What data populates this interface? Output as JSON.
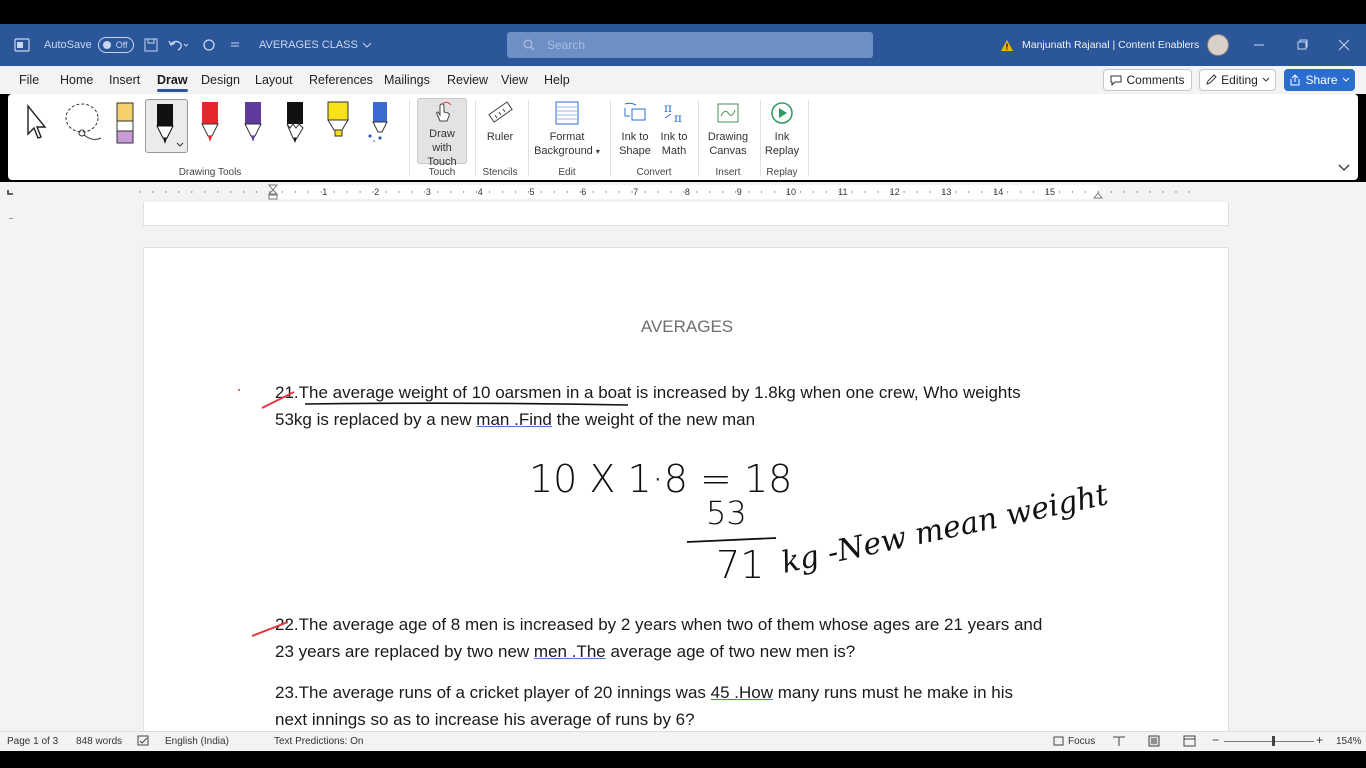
{
  "titlebar": {
    "autosave_label": "AutoSave",
    "autosave_state": "Off",
    "doc_name": "AVERAGES CLASS",
    "search_placeholder": "Search",
    "user": "Manjunath Rajanal | Content Enablers"
  },
  "menu": {
    "tabs": [
      "File",
      "Home",
      "Insert",
      "Draw",
      "Design",
      "Layout",
      "References",
      "Mailings",
      "Review",
      "View",
      "Help"
    ],
    "active_tab": "Draw",
    "comments_label": "Comments",
    "editing_label": "Editing",
    "share_label": "Share"
  },
  "ribbon": {
    "groups": {
      "drawing_tools": "Drawing Tools",
      "touch": "Touch",
      "stencils": "Stencils",
      "edit": "Edit",
      "convert": "Convert",
      "insert": "Insert",
      "replay": "Replay"
    },
    "buttons": {
      "draw_with_touch": "Draw with Touch",
      "ruler": "Ruler",
      "format_background": "Format Background",
      "ink_to_shape": "Ink to Shape",
      "ink_to_math": "Ink to Math",
      "drawing_canvas": "Drawing Canvas",
      "ink_replay": "Ink Replay"
    }
  },
  "ruler": {
    "numbers": [
      "1",
      "2",
      "3",
      "4",
      "5",
      "6",
      "7",
      "8",
      "9",
      "10",
      "11",
      "12",
      "13",
      "14",
      "15"
    ]
  },
  "document": {
    "title": "AVERAGES",
    "q21_line1": "21.The average weight of 10 oarsmen in a boat is increased by 1.8kg when one crew, Who weights",
    "q21_line2_a": "53kg is replaced by a new ",
    "q21_line2_u": "man .Find",
    "q21_line2_b": " the weight of the new man",
    "q22_line1": "22.The average age of 8 men is increased by 2 years when two of them whose ages are 21 years and",
    "q22_line2_a": "23 years are replaced by two new ",
    "q22_line2_u": "men .The",
    "q22_line2_b": " average age of two new men is?",
    "q23_line1_a": "23.The average runs of a cricket player of 20 innings was ",
    "q23_line1_u": "45 .How",
    "q23_line1_b": " many runs must he make in his",
    "q23_line2": "next innings so as to increase his average of runs by 6?",
    "ink": {
      "line1": "10 X 1·8 = 18",
      "line2": "53",
      "line3": "71",
      "note": "kg -New mean weight"
    }
  },
  "status": {
    "page": "Page 1 of 3",
    "words": "848 words",
    "language": "English (India)",
    "predictions": "Text Predictions: On",
    "focus": "Focus",
    "zoom": "154%"
  },
  "colors": {
    "brand": "#2b579a",
    "ink_black": "#111111",
    "ink_red": "#e0393e",
    "share": "#2b6cd0"
  }
}
